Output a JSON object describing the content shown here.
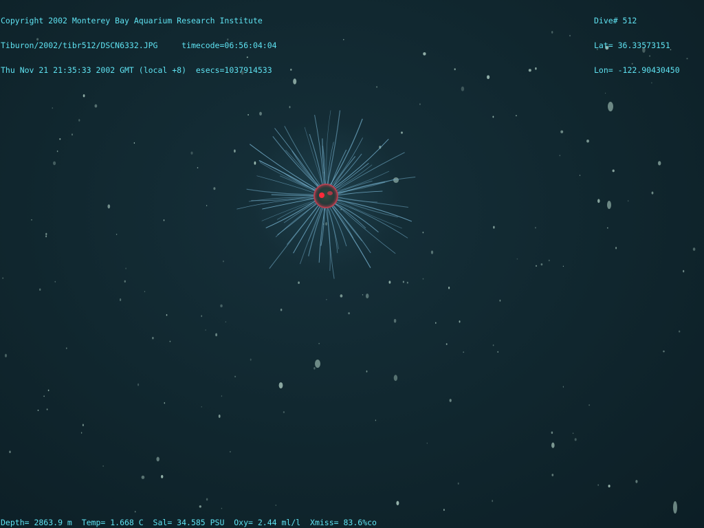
{
  "image": {
    "colors": {
      "water": "#112830",
      "overlay_text": "#5fe3f2",
      "tentacle": "#6fa8c4",
      "bell": "#9a3a44",
      "gut": "#ff2a3a",
      "particle": "#b8d8cc"
    }
  },
  "overlay": {
    "top_left": [
      "Copyright 2002 Monterey Bay Aquarium Research Institute",
      "Tiburon/2002/tibr512/DSCN6332.JPG     timecode=06:56:04:04",
      "Thu Nov 21 21:35:33 2002 GMT (local +8)  esecs=1037914533"
    ],
    "top_right": [
      "Dive# 512",
      "Lat= 36.33573151",
      "Lon= -122.90430450"
    ],
    "bottom": "Depth= 2863.9 m  Temp= 1.668 C  Sal= 34.585 PSU  Oxy= 2.44 ml/l  Xmiss= 83.6%co"
  }
}
